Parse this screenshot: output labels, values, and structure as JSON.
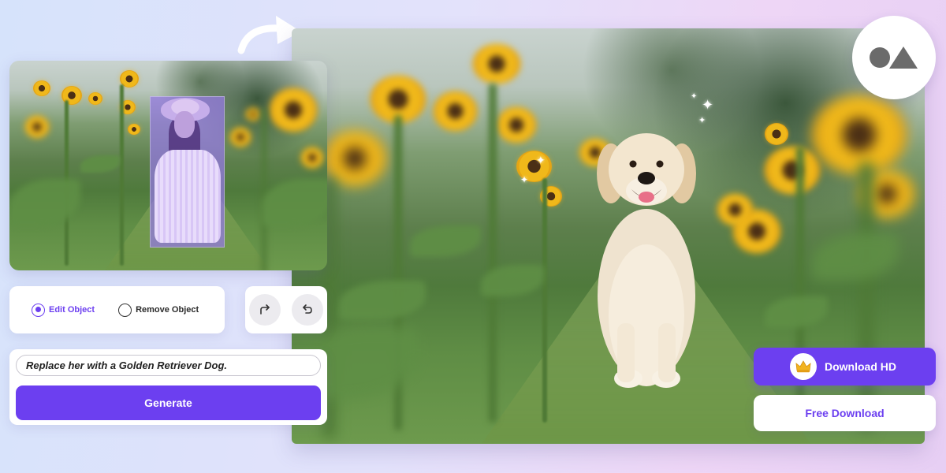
{
  "mode_selector": {
    "options": [
      {
        "label": "Edit Object",
        "selected": true
      },
      {
        "label": "Remove Object",
        "selected": false
      }
    ]
  },
  "history": {
    "redo_icon": "redo-icon",
    "undo_icon": "undo-icon"
  },
  "prompt": {
    "value": "Replace her with a Golden Retriever Dog."
  },
  "generate_label": "Generate",
  "downloads": {
    "hd_label": "Download HD",
    "hd_icon": "crown-icon",
    "free_label": "Free Download"
  },
  "logo": {
    "icon": "circle-triangle-logo-icon"
  },
  "colors": {
    "accent": "#6c3ff0",
    "mask": "#9678e6",
    "background_start": "#d6e3fb",
    "background_end": "#e7cff4"
  }
}
